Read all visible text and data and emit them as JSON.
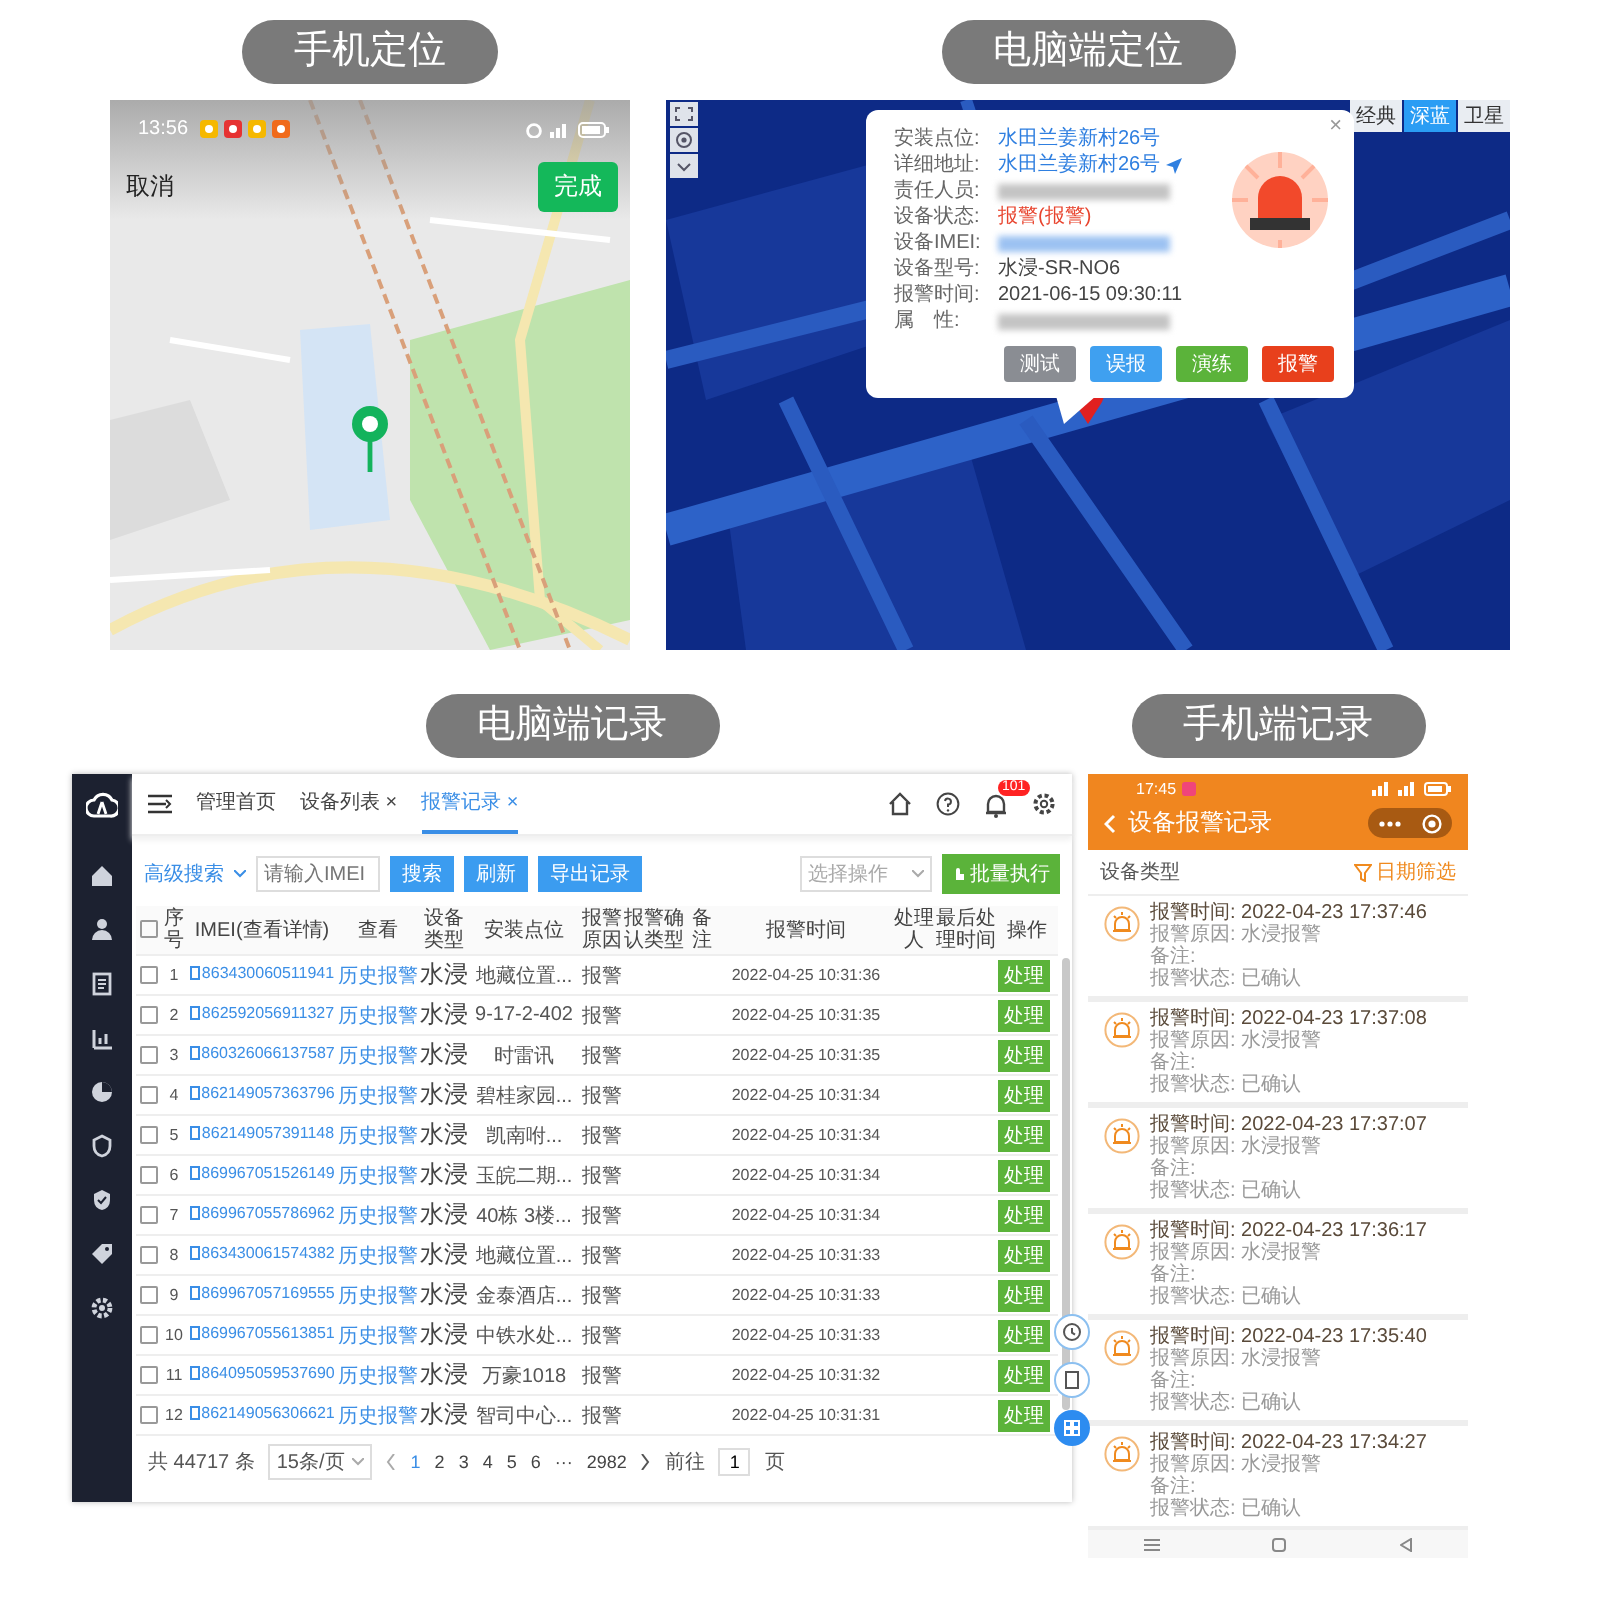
{
  "phone_locate": {
    "title": "手机定位",
    "status_time": "13:56",
    "cancel": "取消",
    "done": "完成"
  },
  "desktop_locate": {
    "title": "电脑端定位",
    "map_types": [
      {
        "label": "经典",
        "selected": false
      },
      {
        "label": "深蓝",
        "selected": true
      },
      {
        "label": "卫星",
        "selected": false
      }
    ],
    "popup": {
      "close": "×",
      "fields": [
        {
          "label": "安装点位:",
          "kind": "link",
          "value": "水田兰姜新村26号"
        },
        {
          "label": "详细地址:",
          "kind": "address",
          "value": "水田兰姜新村26号"
        },
        {
          "label": "责任人员:",
          "kind": "redacted"
        },
        {
          "label": "设备状态:",
          "kind": "alert",
          "value": "报警(报警)"
        },
        {
          "label": "设备IMEI:",
          "kind": "redacted_link"
        },
        {
          "label": "设备型号:",
          "kind": "plain",
          "value": "水浸-SR-NO6"
        },
        {
          "label": "报警时间:",
          "kind": "plain",
          "value": "2021-06-15 09:30:11"
        },
        {
          "label": "属　性:",
          "kind": "redacted"
        }
      ],
      "buttons": [
        {
          "label": "测试",
          "color": "#8a8d93"
        },
        {
          "label": "误报",
          "color": "#3fa0f0"
        },
        {
          "label": "演练",
          "color": "#5bb33a"
        },
        {
          "label": "报警",
          "color": "#e8401c"
        }
      ]
    }
  },
  "desktop_records": {
    "title": "电脑端记录",
    "tabs": [
      {
        "label": "管理首页",
        "selected": false
      },
      {
        "label": "设备列表",
        "close": "×",
        "selected": false
      },
      {
        "label": "报警记录",
        "close": "×",
        "selected": true
      }
    ],
    "notification_badge": "101",
    "search_mode": "高级搜索",
    "search_field": {
      "placeholder": "请输入IMEI"
    },
    "buttons": [
      "搜索",
      "刷新",
      "导出记录"
    ],
    "action_select": {
      "placeholder": "选择操作"
    },
    "batch_button": "批量执行",
    "table": {
      "all_checked": false,
      "columns": [
        {
          "label": "序号",
          "kind": "index"
        },
        {
          "label": "IMEI(查看详情)",
          "kind": "imei"
        },
        {
          "label": "查看",
          "kind": "link"
        },
        {
          "label": "设备类型",
          "kind": "large"
        },
        {
          "label": "安装点位"
        },
        {
          "label": "报警原因"
        },
        {
          "label": "报警确认类型"
        },
        {
          "label": "备注"
        },
        {
          "label": "报警时间",
          "kind": "small"
        },
        {
          "label": "处理人"
        },
        {
          "label": "最后处理时间"
        },
        {
          "label": "操作",
          "kind": "button"
        }
      ],
      "rows": [
        {
          "checked": false,
          "cells": [
            "1",
            "863430060511941",
            "历史报警",
            "水浸",
            "地藏位置...",
            "报警",
            null,
            null,
            "2022-04-25 10:31:36",
            null,
            null,
            "处理"
          ]
        },
        {
          "checked": false,
          "cells": [
            "2",
            "862592056911327",
            "历史报警",
            "水浸",
            "9-17-2-402",
            "报警",
            null,
            null,
            "2022-04-25 10:31:35",
            null,
            null,
            "处理"
          ]
        },
        {
          "checked": false,
          "cells": [
            "3",
            "860326066137587",
            "历史报警",
            "水浸",
            "时雷讯",
            "报警",
            null,
            null,
            "2022-04-25 10:31:35",
            null,
            null,
            "处理"
          ]
        },
        {
          "checked": false,
          "cells": [
            "4",
            "862149057363796",
            "历史报警",
            "水浸",
            "碧桂家园...",
            "报警",
            null,
            null,
            "2022-04-25 10:31:34",
            null,
            null,
            "处理"
          ]
        },
        {
          "checked": false,
          "cells": [
            "5",
            "862149057391148",
            "历史报警",
            "水浸",
            "凯南咐...",
            "报警",
            null,
            null,
            "2022-04-25 10:31:34",
            null,
            null,
            "处理"
          ]
        },
        {
          "checked": false,
          "cells": [
            "6",
            "869967051526149",
            "历史报警",
            "水浸",
            "玉皖二期...",
            "报警",
            null,
            null,
            "2022-04-25 10:31:34",
            null,
            null,
            "处理"
          ]
        },
        {
          "checked": false,
          "cells": [
            "7",
            "869967055786962",
            "历史报警",
            "水浸",
            "40栋 3楼...",
            "报警",
            null,
            null,
            "2022-04-25 10:31:34",
            null,
            null,
            "处理"
          ]
        },
        {
          "checked": false,
          "cells": [
            "8",
            "863430061574382",
            "历史报警",
            "水浸",
            "地藏位置...",
            "报警",
            null,
            null,
            "2022-04-25 10:31:33",
            null,
            null,
            "处理"
          ]
        },
        {
          "checked": false,
          "cells": [
            "9",
            "869967057169555",
            "历史报警",
            "水浸",
            "金泰酒店...",
            "报警",
            null,
            null,
            "2022-04-25 10:31:33",
            null,
            null,
            "处理"
          ]
        },
        {
          "checked": false,
          "cells": [
            "10",
            "869967055613851",
            "历史报警",
            "水浸",
            "中铁水处...",
            "报警",
            null,
            null,
            "2022-04-25 10:31:33",
            null,
            null,
            "处理"
          ]
        },
        {
          "checked": false,
          "cells": [
            "11",
            "864095059537690",
            "历史报警",
            "水浸",
            "万豪1018",
            "报警",
            null,
            null,
            "2022-04-25 10:31:32",
            null,
            null,
            "处理"
          ]
        },
        {
          "checked": false,
          "cells": [
            "12",
            "862149056306621",
            "历史报警",
            "水浸",
            "智司中心...",
            "报警",
            null,
            null,
            "2022-04-25 10:31:31",
            null,
            null,
            "处理"
          ]
        }
      ]
    },
    "pagination": {
      "total": "共 44717 条",
      "page_size": "15条/页",
      "pages": [
        {
          "label": "1",
          "selected": true
        },
        {
          "label": "2",
          "selected": false
        },
        {
          "label": "3",
          "selected": false
        },
        {
          "label": "4",
          "selected": false
        },
        {
          "label": "5",
          "selected": false
        },
        {
          "label": "6",
          "selected": false
        },
        {
          "label": "···",
          "selected": false
        },
        {
          "label": "2982",
          "selected": false
        }
      ],
      "goto_label": "前往",
      "goto_value": "1",
      "goto_suffix": "页"
    }
  },
  "phone_records": {
    "title": "手机端记录",
    "status_time": "17:45",
    "header_title": "设备报警记录",
    "filter_label": "设备类型",
    "date_filter": "日期筛选",
    "records": [
      {
        "time": "报警时间: 2022-04-23 17:37:46",
        "reason": "报警原因: 水浸报警",
        "note": "备注:",
        "state": "报警状态: 已确认"
      },
      {
        "time": "报警时间: 2022-04-23 17:37:08",
        "reason": "报警原因: 水浸报警",
        "note": "备注:",
        "state": "报警状态: 已确认"
      },
      {
        "time": "报警时间: 2022-04-23 17:37:07",
        "reason": "报警原因: 水浸报警",
        "note": "备注:",
        "state": "报警状态: 已确认"
      },
      {
        "time": "报警时间: 2022-04-23 17:36:17",
        "reason": "报警原因: 水浸报警",
        "note": "备注:",
        "state": "报警状态: 已确认"
      },
      {
        "time": "报警时间: 2022-04-23 17:35:40",
        "reason": "报警原因: 水浸报警",
        "note": "备注:",
        "state": "报警状态: 已确认"
      },
      {
        "time": "报警时间: 2022-04-23 17:34:27",
        "reason": "报警原因: 水浸报警",
        "note": "备注:",
        "state": "报警状态: 已确认"
      }
    ]
  }
}
